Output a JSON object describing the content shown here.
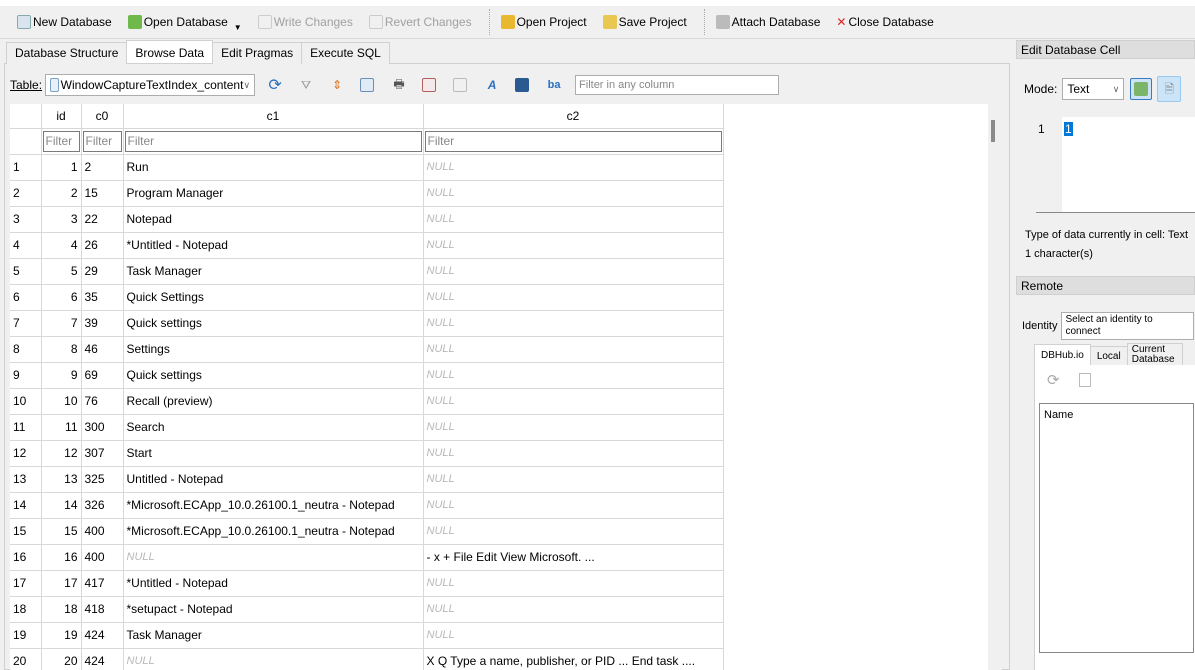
{
  "toolbar": {
    "new_db": "New Database",
    "open_db": "Open Database",
    "write": "Write Changes",
    "revert": "Revert Changes",
    "open_project": "Open Project",
    "save_project": "Save Project",
    "attach": "Attach Database",
    "close": "Close Database"
  },
  "tabs": [
    "Database Structure",
    "Browse Data",
    "Edit Pragmas",
    "Execute SQL"
  ],
  "browse": {
    "table_label": "Table:",
    "table_value": "WindowCaptureTextIndex_content",
    "filter_placeholder": "Filter in any column"
  },
  "grid": {
    "columns": [
      "id",
      "c0",
      "c1",
      "c2"
    ],
    "filter_placeholder": "Filter",
    "null_text": "NULL",
    "rows": [
      [
        1,
        "2",
        "Run",
        null
      ],
      [
        2,
        "15",
        "Program Manager",
        null
      ],
      [
        3,
        "22",
        "Notepad",
        null
      ],
      [
        4,
        "26",
        "*Untitled - Notepad",
        null
      ],
      [
        5,
        "29",
        "Task Manager",
        null
      ],
      [
        6,
        "35",
        "Quick Settings",
        null
      ],
      [
        7,
        "39",
        "Quick settings",
        null
      ],
      [
        8,
        "46",
        "Settings",
        null
      ],
      [
        9,
        "69",
        "Quick settings",
        null
      ],
      [
        10,
        "76",
        "Recall (preview)",
        null
      ],
      [
        11,
        "300",
        "Search",
        null
      ],
      [
        12,
        "307",
        "Start",
        null
      ],
      [
        13,
        "325",
        "Untitled - Notepad",
        null
      ],
      [
        14,
        "326",
        "*Microsoft.ECApp_10.0.26100.1_neutra - Notepad",
        null
      ],
      [
        15,
        "400",
        "*Microsoft.ECApp_10.0.26100.1_neutra - Notepad",
        null
      ],
      [
        16,
        "400",
        null,
        "- x + File Edit View Microsoft. ..."
      ],
      [
        17,
        "417",
        "*Untitled - Notepad",
        null
      ],
      [
        18,
        "418",
        "*setupact - Notepad",
        null
      ],
      [
        19,
        "424",
        "Task Manager",
        null
      ],
      [
        20,
        "424",
        null,
        "X Q Type a name, publisher, or PID ... End task ...."
      ]
    ]
  },
  "edit_cell": {
    "title": "Edit Database Cell",
    "mode_label": "Mode:",
    "mode_value": "Text",
    "line_no": "1",
    "content": "1",
    "type_info": "Type of data currently in cell: Text",
    "char_count": "1 character(s)"
  },
  "remote": {
    "title": "Remote",
    "identity_label": "Identity",
    "identity_value": "Select an identity to connect",
    "tabs": [
      "DBHub.io",
      "Local",
      "Current Database"
    ],
    "name_header": "Name"
  },
  "colors": {
    "selection": "#0078d7",
    "null": "#b8b8b8"
  }
}
